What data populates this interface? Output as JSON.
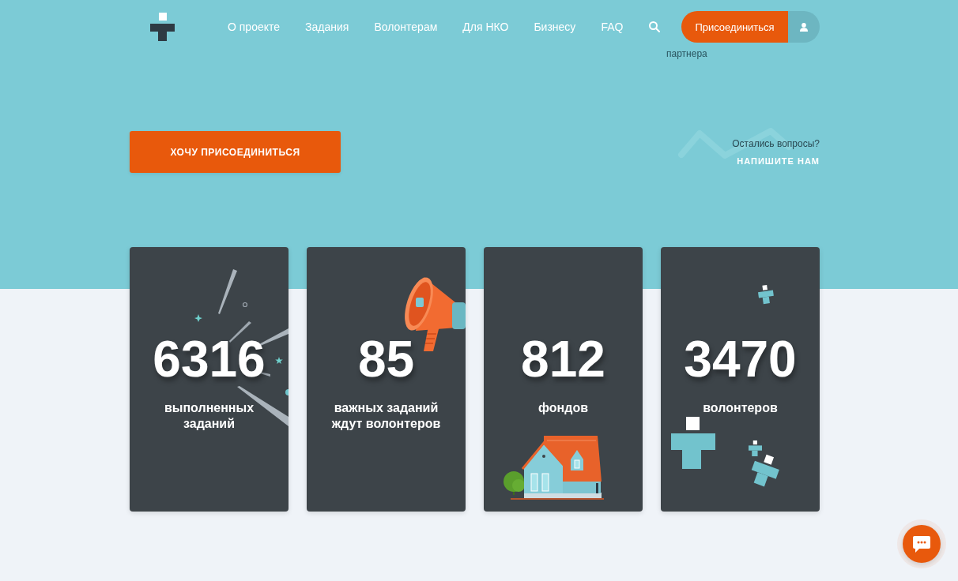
{
  "header": {
    "nav": [
      {
        "label": "О проекте"
      },
      {
        "label": "Задания"
      },
      {
        "label": "Волонтерам"
      },
      {
        "label": "Для НКО"
      },
      {
        "label": "Бизнесу"
      },
      {
        "label": "FAQ"
      }
    ],
    "join_button": "Присоединиться"
  },
  "caption_fragment": "партнера",
  "hero": {
    "cta_button": "ХОЧУ ПРИСОЕДИНИТЬСЯ",
    "contact": {
      "question": "Остались вопросы?",
      "link": "НАПИШИТЕ НАМ"
    }
  },
  "stats": [
    {
      "value": "6316",
      "label": "выполненных заданий"
    },
    {
      "value": "85",
      "label": "важных заданий ждут волонтеров"
    },
    {
      "value": "812",
      "label": "фондов"
    },
    {
      "value": "3470",
      "label": "волонтеров"
    }
  ]
}
